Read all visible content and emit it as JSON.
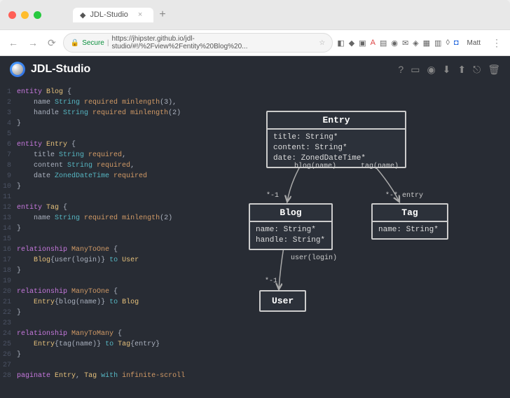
{
  "browser": {
    "tab_title": "JDL-Studio",
    "url": "https://jhipster.github.io/jdl-studio/#!/%2Fview%2Fentity%20Blog%20...",
    "secure_label": "Secure",
    "user": "Matt"
  },
  "app": {
    "title": "JDL-Studio"
  },
  "code_lines": [
    {
      "n": 1,
      "tokens": [
        [
          "kw",
          "entity"
        ],
        [
          "txt",
          " "
        ],
        [
          "ident",
          "Blog"
        ],
        [
          "txt",
          " {"
        ]
      ]
    },
    {
      "n": 2,
      "tokens": [
        [
          "txt",
          "    name "
        ],
        [
          "type",
          "String"
        ],
        [
          "txt",
          " "
        ],
        [
          "mod",
          "required"
        ],
        [
          "txt",
          " "
        ],
        [
          "mod",
          "minlength"
        ],
        [
          "txt",
          "(3),"
        ]
      ]
    },
    {
      "n": 3,
      "tokens": [
        [
          "txt",
          "    handle "
        ],
        [
          "type",
          "String"
        ],
        [
          "txt",
          " "
        ],
        [
          "mod",
          "required"
        ],
        [
          "txt",
          " "
        ],
        [
          "mod",
          "minlength"
        ],
        [
          "txt",
          "(2)"
        ]
      ]
    },
    {
      "n": 4,
      "tokens": [
        [
          "txt",
          "}"
        ]
      ]
    },
    {
      "n": 5,
      "tokens": [
        [
          "txt",
          ""
        ]
      ]
    },
    {
      "n": 6,
      "tokens": [
        [
          "kw",
          "entity"
        ],
        [
          "txt",
          " "
        ],
        [
          "ident",
          "Entry"
        ],
        [
          "txt",
          " {"
        ]
      ]
    },
    {
      "n": 7,
      "tokens": [
        [
          "txt",
          "    title "
        ],
        [
          "type",
          "String"
        ],
        [
          "txt",
          " "
        ],
        [
          "mod",
          "required"
        ],
        [
          "txt",
          ","
        ]
      ]
    },
    {
      "n": 8,
      "tokens": [
        [
          "txt",
          "    content "
        ],
        [
          "type",
          "String"
        ],
        [
          "txt",
          " "
        ],
        [
          "mod",
          "required"
        ],
        [
          "txt",
          ","
        ]
      ]
    },
    {
      "n": 9,
      "tokens": [
        [
          "txt",
          "    date "
        ],
        [
          "type",
          "ZonedDateTime"
        ],
        [
          "txt",
          " "
        ],
        [
          "mod",
          "required"
        ]
      ]
    },
    {
      "n": 10,
      "tokens": [
        [
          "txt",
          "}"
        ]
      ]
    },
    {
      "n": 11,
      "tokens": [
        [
          "txt",
          ""
        ]
      ]
    },
    {
      "n": 12,
      "tokens": [
        [
          "kw",
          "entity"
        ],
        [
          "txt",
          " "
        ],
        [
          "ident",
          "Tag"
        ],
        [
          "txt",
          " {"
        ]
      ]
    },
    {
      "n": 13,
      "tokens": [
        [
          "txt",
          "    name "
        ],
        [
          "type",
          "String"
        ],
        [
          "txt",
          " "
        ],
        [
          "mod",
          "required"
        ],
        [
          "txt",
          " "
        ],
        [
          "mod",
          "minlength"
        ],
        [
          "txt",
          "(2)"
        ]
      ]
    },
    {
      "n": 14,
      "tokens": [
        [
          "txt",
          "}"
        ]
      ]
    },
    {
      "n": 15,
      "tokens": [
        [
          "txt",
          ""
        ]
      ]
    },
    {
      "n": 16,
      "tokens": [
        [
          "rel",
          "relationship"
        ],
        [
          "txt",
          " "
        ],
        [
          "mod",
          "ManyToOne"
        ],
        [
          "txt",
          " {"
        ]
      ]
    },
    {
      "n": 17,
      "tokens": [
        [
          "txt",
          "    "
        ],
        [
          "ident",
          "Blog"
        ],
        [
          "txt",
          "{"
        ],
        [
          "txt",
          "user(login)"
        ],
        [
          "txt",
          "} "
        ],
        [
          "to",
          "to"
        ],
        [
          "txt",
          " "
        ],
        [
          "ident",
          "User"
        ]
      ]
    },
    {
      "n": 18,
      "tokens": [
        [
          "txt",
          "}"
        ]
      ]
    },
    {
      "n": 19,
      "tokens": [
        [
          "txt",
          ""
        ]
      ]
    },
    {
      "n": 20,
      "tokens": [
        [
          "rel",
          "relationship"
        ],
        [
          "txt",
          " "
        ],
        [
          "mod",
          "ManyToOne"
        ],
        [
          "txt",
          " {"
        ]
      ]
    },
    {
      "n": 21,
      "tokens": [
        [
          "txt",
          "    "
        ],
        [
          "ident",
          "Entry"
        ],
        [
          "txt",
          "{"
        ],
        [
          "txt",
          "blog(name)"
        ],
        [
          "txt",
          "} "
        ],
        [
          "to",
          "to"
        ],
        [
          "txt",
          " "
        ],
        [
          "ident",
          "Blog"
        ]
      ]
    },
    {
      "n": 22,
      "tokens": [
        [
          "txt",
          "}"
        ]
      ]
    },
    {
      "n": 23,
      "tokens": [
        [
          "txt",
          ""
        ]
      ]
    },
    {
      "n": 24,
      "tokens": [
        [
          "rel",
          "relationship"
        ],
        [
          "txt",
          " "
        ],
        [
          "mod",
          "ManyToMany"
        ],
        [
          "txt",
          " {"
        ]
      ]
    },
    {
      "n": 25,
      "tokens": [
        [
          "txt",
          "    "
        ],
        [
          "ident",
          "Entry"
        ],
        [
          "txt",
          "{"
        ],
        [
          "txt",
          "tag(name)"
        ],
        [
          "txt",
          "} "
        ],
        [
          "to",
          "to"
        ],
        [
          "txt",
          " "
        ],
        [
          "ident",
          "Tag"
        ],
        [
          "txt",
          "{"
        ],
        [
          "txt",
          "entry"
        ],
        [
          "txt",
          "}"
        ]
      ]
    },
    {
      "n": 26,
      "tokens": [
        [
          "txt",
          "}"
        ]
      ]
    },
    {
      "n": 27,
      "tokens": [
        [
          "txt",
          ""
        ]
      ]
    },
    {
      "n": 28,
      "tokens": [
        [
          "kw",
          "paginate"
        ],
        [
          "txt",
          " "
        ],
        [
          "ident",
          "Entry"
        ],
        [
          "txt",
          ", "
        ],
        [
          "ident",
          "Tag"
        ],
        [
          "txt",
          " "
        ],
        [
          "to",
          "with"
        ],
        [
          "txt",
          " "
        ],
        [
          "mod",
          "infinite-scroll"
        ]
      ]
    }
  ],
  "diagram": {
    "entry": {
      "name": "Entry",
      "fields": [
        "title: String*",
        "content: String*",
        "date: ZonedDateTime*"
      ]
    },
    "blog": {
      "name": "Blog",
      "fields": [
        "name: String*",
        "handle: String*"
      ]
    },
    "tag": {
      "name": "Tag",
      "fields": [
        "name: String*"
      ]
    },
    "user": {
      "name": "User"
    },
    "edge_labels": {
      "entry_blog": "blog(name)",
      "entry_tag": "tag(name)",
      "blog_card_left": "*-1",
      "tag_card": "*-* entry",
      "blog_user_rel": "user(login)",
      "user_card": "*-1"
    }
  }
}
